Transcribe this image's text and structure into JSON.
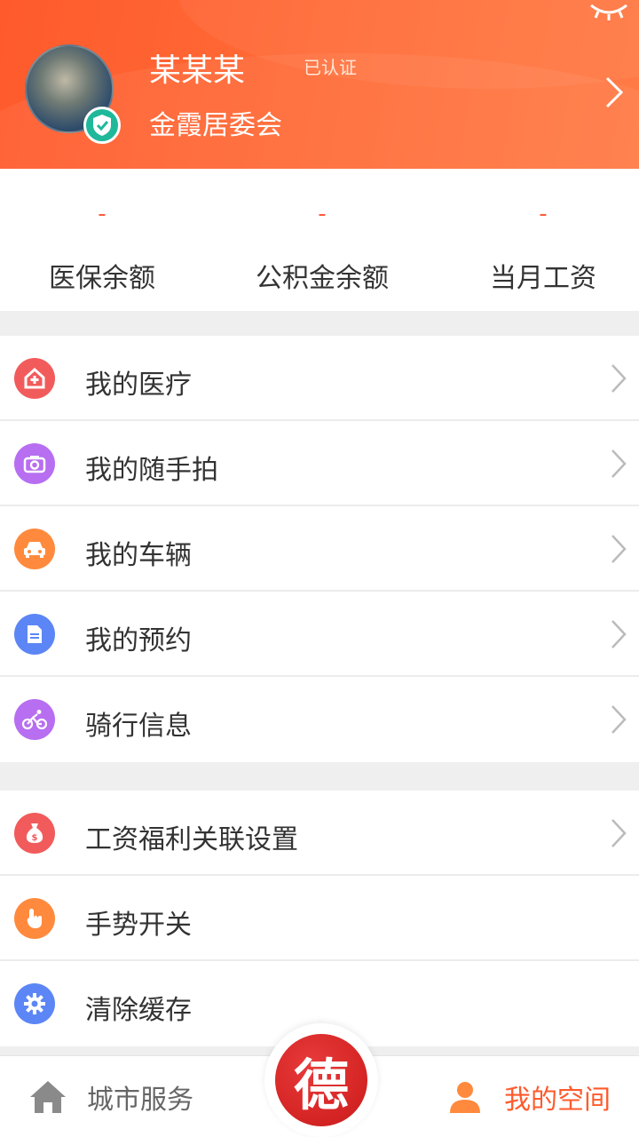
{
  "header": {
    "name": "某某某",
    "cert_label": "已认证",
    "org": "金霞居委会"
  },
  "balances": [
    {
      "value": "-",
      "label": "医保余额"
    },
    {
      "value": "-",
      "label": "公积金余额"
    },
    {
      "value": "-",
      "label": "当月工资"
    }
  ],
  "menu1": [
    {
      "label": "我的医疗",
      "icon": "medical-house-icon",
      "color": "#f25b5b"
    },
    {
      "label": "我的随手拍",
      "icon": "camera-icon",
      "color": "#b76ef0"
    },
    {
      "label": "我的车辆",
      "icon": "car-icon",
      "color": "#ff8a3d"
    },
    {
      "label": "我的预约",
      "icon": "document-icon",
      "color": "#5c86f5"
    },
    {
      "label": "骑行信息",
      "icon": "bicycle-icon",
      "color": "#b76ef0"
    }
  ],
  "menu2": [
    {
      "label": "工资福利关联设置",
      "icon": "money-bag-icon",
      "color": "#f25b5b"
    },
    {
      "label": "手势开关",
      "icon": "gesture-icon",
      "color": "#ff8a3d"
    },
    {
      "label": "清除缓存",
      "icon": "gear-icon",
      "color": "#5c86f5"
    }
  ],
  "nav": {
    "left_label": "城市服务",
    "center_label": "德",
    "right_label": "我的空间"
  },
  "colors": {
    "accent": "#ff5a2c",
    "verified": "#1fb89a"
  }
}
